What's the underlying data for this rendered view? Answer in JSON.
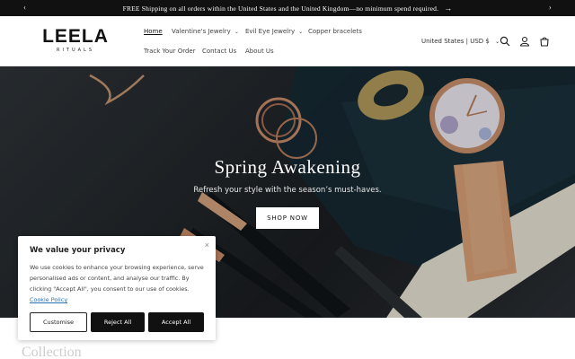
{
  "announcement": {
    "text": "FREE Shipping on all orders within the United States and the United Kingdom—no minimum spend required.",
    "prev_icon": "chevron-left-icon",
    "next_icon": "chevron-right-icon",
    "go_icon": "arrow-right-icon"
  },
  "brand": {
    "name": "LEELA",
    "tagline": "RITUALS"
  },
  "nav": {
    "home": "Home",
    "valentines": "Valentine's Jewelry",
    "evil_eye": "Evil Eye Jewelry",
    "copper": "Copper bracelets",
    "track": "Track Your Order",
    "contact": "Contact Us",
    "about": "About Us"
  },
  "header": {
    "country": "United States | USD $",
    "icons": [
      "search-icon",
      "account-icon",
      "cart-icon"
    ]
  },
  "hero": {
    "title": "Spring Awakening",
    "subtitle": "Refresh your style with the season’s must-haves.",
    "button": "SHOP NOW"
  },
  "section": {
    "title": "Collection"
  },
  "cookie": {
    "title": "We value your privacy",
    "body": "We use cookies to enhance your browsing experience, serve personalised ads or content, and analyse our traffic. By clicking \"Accept All\", you consent to our use of cookies.",
    "link": "Cookie Policy",
    "customise": "Customise",
    "reject": "Reject All",
    "accept": "Accept All"
  }
}
